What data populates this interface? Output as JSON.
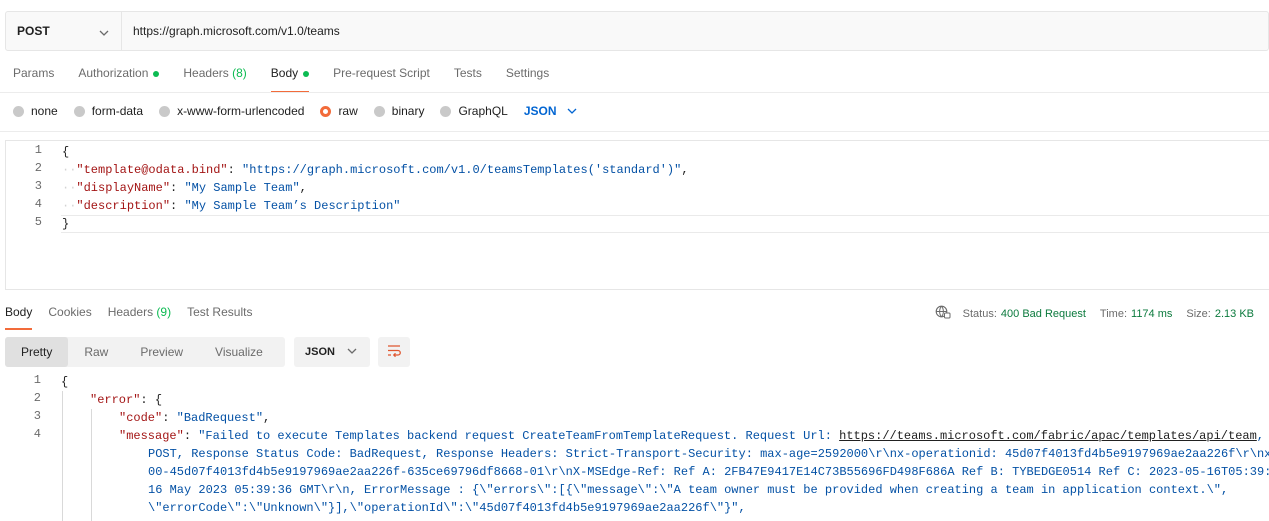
{
  "request": {
    "method": "POST",
    "url": "https://graph.microsoft.com/v1.0/teams"
  },
  "request_tabs": [
    {
      "label": "Params"
    },
    {
      "label": "Authorization",
      "dot": true
    },
    {
      "label": "Headers",
      "count": "(8)"
    },
    {
      "label": "Body",
      "dot": true,
      "active": true
    },
    {
      "label": "Pre-request Script"
    },
    {
      "label": "Tests"
    },
    {
      "label": "Settings"
    }
  ],
  "body_types": {
    "options": [
      "none",
      "form-data",
      "x-www-form-urlencoded",
      "raw",
      "binary",
      "GraphQL"
    ],
    "selected": "raw",
    "format": "JSON"
  },
  "request_body": {
    "line_numbers": [
      "1",
      "2",
      "3",
      "4",
      "5"
    ],
    "open_brace": "{",
    "close_brace": "}",
    "lines": [
      {
        "key": "\"template@odata.bind\"",
        "sep": ": ",
        "value": "\"https://graph.microsoft.com/v1.0/teamsTemplates('standard')\"",
        "end": ","
      },
      {
        "key": "\"displayName\"",
        "sep": ": ",
        "value": "\"My Sample Team\"",
        "end": ","
      },
      {
        "key": "\"description\"",
        "sep": ": ",
        "value": "\"My Sample Team’s Description\"",
        "end": ""
      }
    ]
  },
  "response_tabs": [
    {
      "label": "Body",
      "active": true
    },
    {
      "label": "Cookies"
    },
    {
      "label": "Headers",
      "count": "(9)"
    },
    {
      "label": "Test Results"
    }
  ],
  "response_status": {
    "status_label": "Status:",
    "status_value": "400 Bad Request",
    "time_label": "Time:",
    "time_value": "1174 ms",
    "size_label": "Size:",
    "size_value": "2.13 KB"
  },
  "response_views": [
    "Pretty",
    "Raw",
    "Preview",
    "Visualize"
  ],
  "response_format": "JSON",
  "response_body": {
    "line_numbers": [
      "1",
      "2",
      "3",
      "4"
    ],
    "l1": "{",
    "l2_key": "\"error\"",
    "l2_rest": ": {",
    "l3_key": "\"code\"",
    "l3_sep": ": ",
    "l3_val": "\"BadRequest\"",
    "l3_end": ",",
    "l4_key": "\"message\"",
    "l4_sep": ": ",
    "l4_val_a": "\"Failed to execute Templates backend request CreateTeamFromTemplateRequest. Request Url: ",
    "l4_link": "https://teams.microsoft.com/fabric/apac/templates/api/team",
    "l4_val_b": ",",
    "w1": "POST, Response Status Code: BadRequest, Response Headers: Strict-Transport-Security: max-age=2592000\\r\\nx-operationid: 45d07f4013fd4b5e9197969ae2aa226f\\r\\nx",
    "w2": "00-45d07f4013fd4b5e9197969ae2aa226f-635ce69796df8668-01\\r\\nX-MSEdge-Ref: Ref A: 2FB47E9417E14C73B55696FD498F686A Ref B: TYBEDGE0514 Ref C: 2023-05-16T05:39:",
    "w3": "16 May 2023 05:39:36 GMT\\r\\n, ErrorMessage : {\\\"errors\\\":[{\\\"message\\\":\\\"A team owner must be provided when creating a team in application context.\\\",",
    "w4": "\\\"errorCode\\\":\\\"Unknown\\\"}],\\\"operationId\\\":\\\"45d07f4013fd4b5e9197969ae2aa226f\\\"}\","
  }
}
